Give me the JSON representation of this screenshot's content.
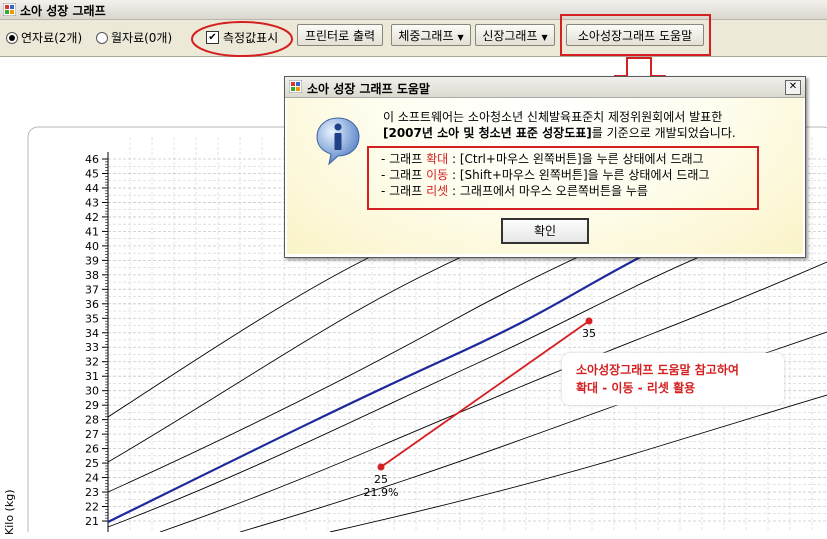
{
  "window": {
    "title": "소아 성장 그래프"
  },
  "toolbar": {
    "radio_years": "연자료(2개)",
    "radio_months": "월자료(0개)",
    "show_values_label": "측정값표시",
    "print_button": "프린터로 출력",
    "weight_dropdown": "체중그래프",
    "height_dropdown": "신장그래프",
    "help_button": "소아성장그래프 도움말"
  },
  "dialog": {
    "title": "소아 성장 그래프 도움말",
    "close_glyph": "✕",
    "intro_line1": "이 소프트웨어는 소아청소년 신체발육표준치 제정위원회에서 발표한",
    "intro_line2_bold": "[2007년 소아 및 청소년 표준 성장도표]",
    "intro_line2_rest": "를 기준으로 개발되었습니다.",
    "help_rows": [
      {
        "prefix": "- 그래프 ",
        "action": "확대",
        "rest": " : [Ctrl+마우스 왼쪽버튼]을 누른 상태에서 드래그"
      },
      {
        "prefix": "- 그래프 ",
        "action": "이동",
        "rest": " : [Shift+마우스 왼쪽버튼]을 누른 상태에서 드래그"
      },
      {
        "prefix": "- 그래프 ",
        "action": "리셋",
        "rest": " : 그래프에서 마우스 오른쪽버튼을 누름"
      }
    ],
    "ok_button": "확인"
  },
  "annotation": {
    "line1": "소아성장그래프 도움말 참고하여",
    "line2": "확대 - 이동 - 리셋 활용"
  },
  "chart_data": {
    "type": "line",
    "ylabel": "Kilo (kg)",
    "ylim": [
      21,
      46
    ],
    "y_ticks": [
      "46",
      "45",
      "44",
      "43",
      "42",
      "41",
      "40",
      "39",
      "38",
      "37",
      "36",
      "35",
      "34",
      "33",
      "32",
      "31",
      "30",
      "29",
      "28",
      "27",
      "26",
      "25",
      "24",
      "23",
      "22",
      "21"
    ],
    "measurements": [
      {
        "label": "25",
        "sub": "21.9%"
      },
      {
        "label": "35",
        "sub": ""
      }
    ],
    "colors": {
      "measurement": "#d42020",
      "median": "#1c2a9c",
      "percentile": "#000000",
      "grid": "#c8c8c8"
    }
  }
}
